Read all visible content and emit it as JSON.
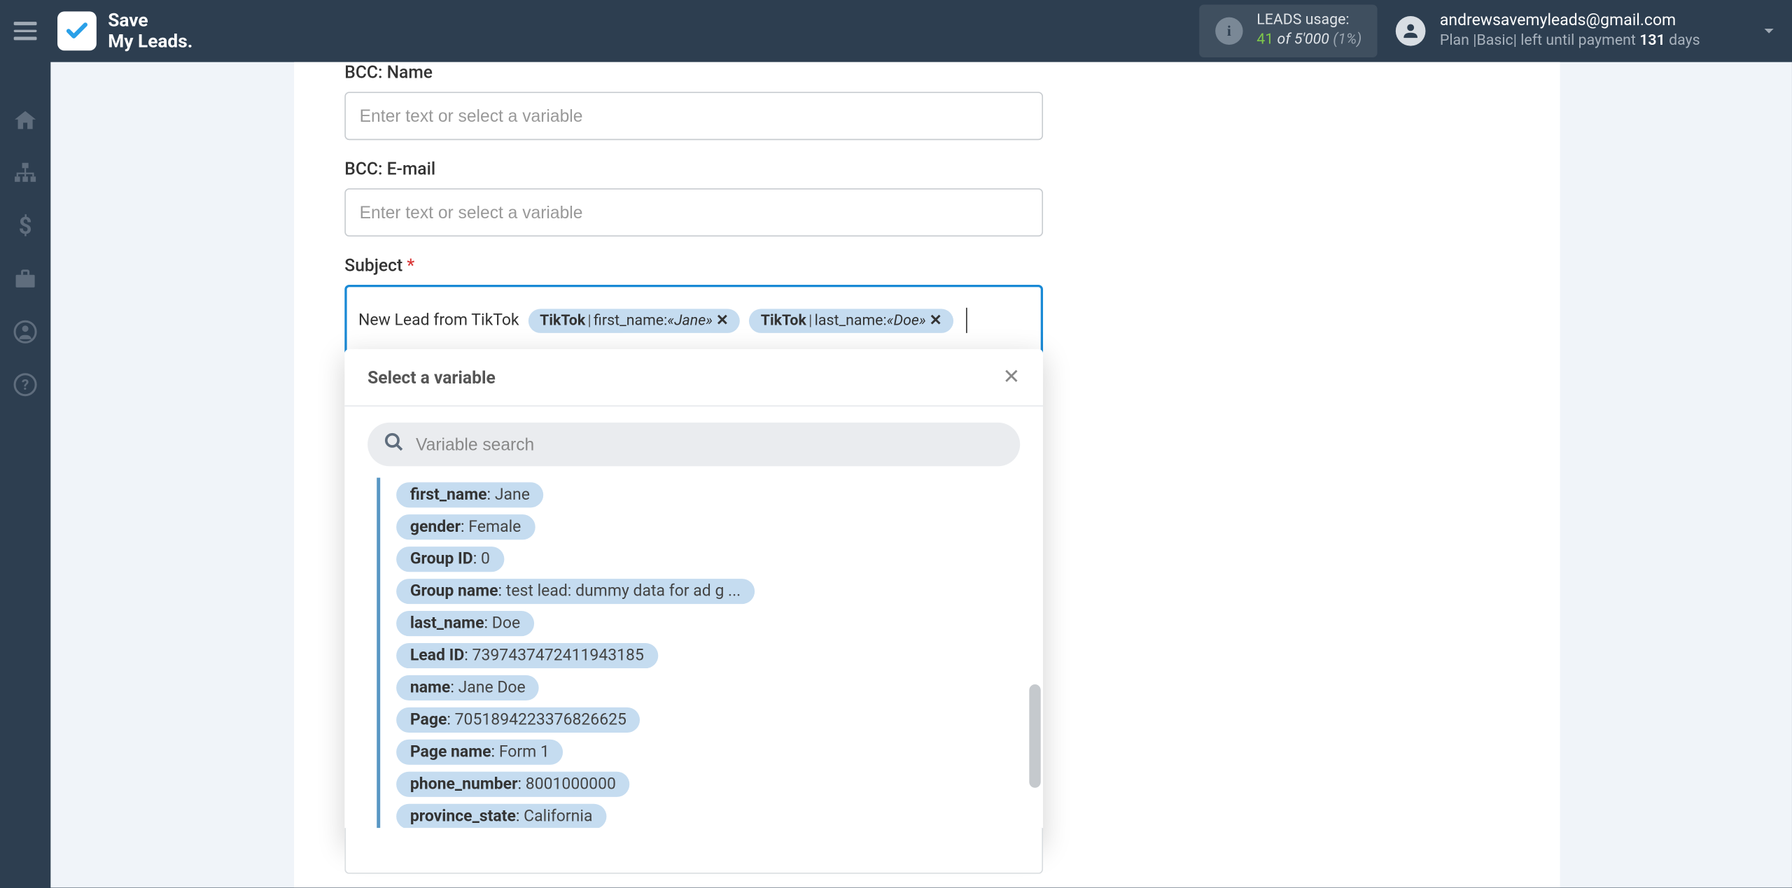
{
  "header": {
    "logo_line1": "Save",
    "logo_line2": "My Leads.",
    "usage": {
      "label": "LEADS usage:",
      "current": "41",
      "of_word": "of",
      "total": "5'000",
      "percent": "(1%)"
    },
    "user": {
      "email": "andrewsavemyleads@gmail.com",
      "plan_prefix": "Plan |",
      "plan_name": "Basic",
      "plan_mid": "| left until payment ",
      "days": "131",
      "days_suffix": " days"
    }
  },
  "form": {
    "bcc_name_label": "BCC: Name",
    "bcc_name_placeholder": "Enter text or select a variable",
    "bcc_email_label": "BCC: E-mail",
    "bcc_email_placeholder": "Enter text or select a variable",
    "subject_label": "Subject",
    "subject_text": "New Lead from TikTok",
    "subject_chips": [
      {
        "source": "TikTok",
        "field": "first_name:",
        "value": "«Jane»"
      },
      {
        "source": "TikTok",
        "field": "last_name:",
        "value": "«Doe»"
      }
    ]
  },
  "dropdown": {
    "title": "Select a variable",
    "search_placeholder": "Variable search",
    "variables": [
      {
        "key": "first_name",
        "value": "Jane"
      },
      {
        "key": "gender",
        "value": "Female"
      },
      {
        "key": "Group ID",
        "value": "0"
      },
      {
        "key": "Group name",
        "value": "test lead: dummy data for ad g ..."
      },
      {
        "key": "last_name",
        "value": "Doe"
      },
      {
        "key": "Lead ID",
        "value": "7397437472411943185"
      },
      {
        "key": "name",
        "value": "Jane Doe"
      },
      {
        "key": "Page",
        "value": "7051894223376826625"
      },
      {
        "key": "Page name",
        "value": "Form 1"
      },
      {
        "key": "phone_number",
        "value": "8001000000"
      },
      {
        "key": "province_state",
        "value": "California"
      }
    ]
  }
}
